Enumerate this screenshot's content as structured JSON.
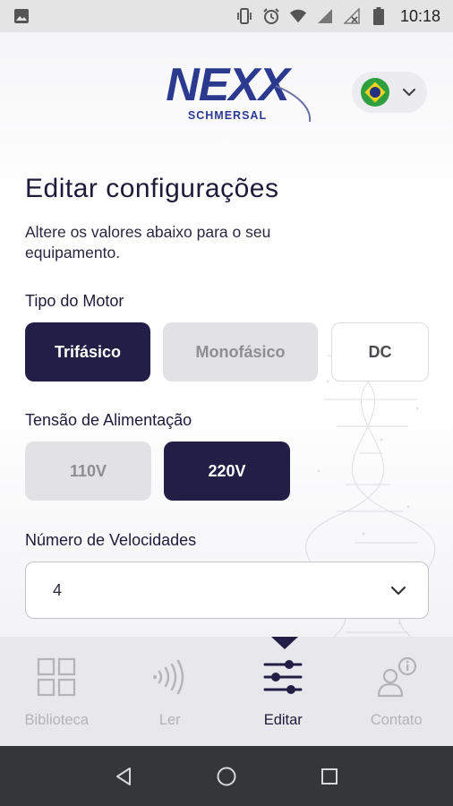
{
  "status_bar": {
    "time": "10:18",
    "icons": [
      "image-icon",
      "vibrate-icon",
      "alarm-icon",
      "wifi-icon",
      "signal-icon",
      "signal-x-icon",
      "battery-icon"
    ]
  },
  "header": {
    "logo_text": "NEXX",
    "logo_subtext": "SCHMERSAL",
    "language": {
      "flag": "brazil-flag-icon",
      "chevron": "chevron-down-icon"
    }
  },
  "page": {
    "title": "Editar configurações",
    "subtitle": "Altere os valores abaixo para o seu equipamento."
  },
  "motor_type": {
    "label": "Tipo do Motor",
    "options": [
      {
        "label": "Trifásico",
        "selected": true
      },
      {
        "label": "Monofásico",
        "selected": false
      },
      {
        "label": "DC",
        "selected": false
      }
    ]
  },
  "voltage": {
    "label": "Tensão de Alimentação",
    "options": [
      {
        "label": "110V",
        "selected": false
      },
      {
        "label": "220V",
        "selected": true
      }
    ]
  },
  "speeds": {
    "label": "Número de Velocidades",
    "value": "4"
  },
  "tabs": [
    {
      "label": "Biblioteca",
      "icon": "grid-icon",
      "active": false
    },
    {
      "label": "Ler",
      "icon": "nfc-icon",
      "active": false
    },
    {
      "label": "Editar",
      "icon": "sliders-icon",
      "active": true
    },
    {
      "label": "Contato",
      "icon": "contact-info-icon",
      "active": false
    }
  ],
  "colors": {
    "primary": "#221e46",
    "unselected": "#e2e2e4",
    "tab_bar": "#e8e8ec",
    "nav_bar": "#343638",
    "logo_blue": "#2b3a8f"
  }
}
